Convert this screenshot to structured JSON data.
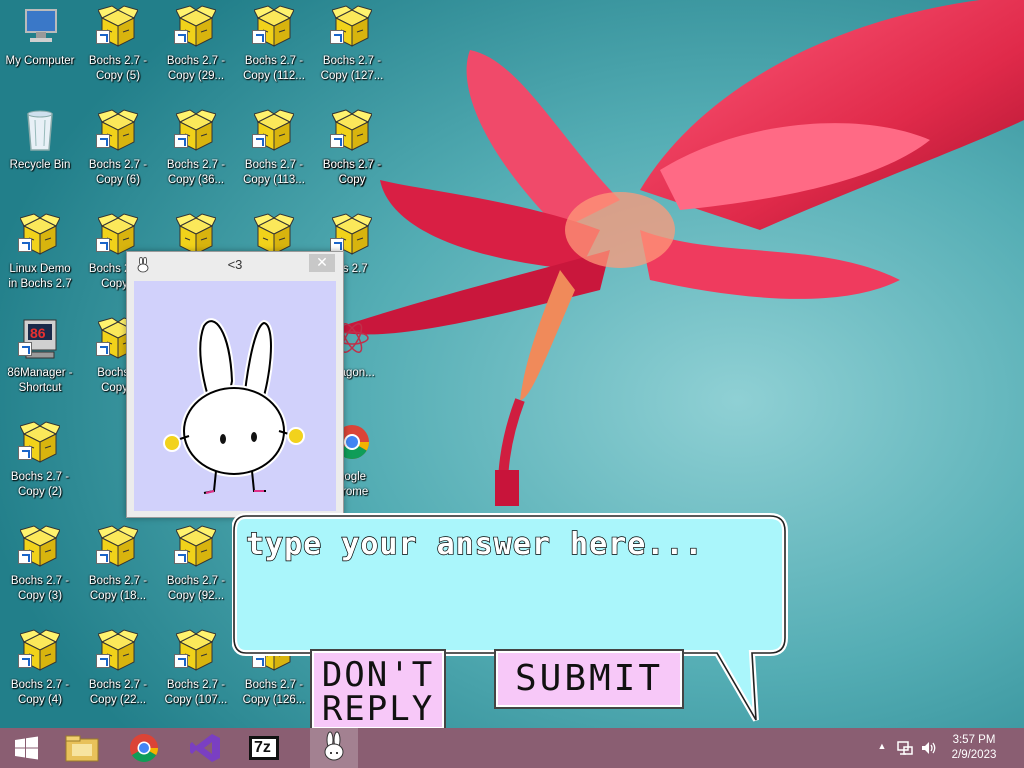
{
  "desktop": {
    "icons": [
      {
        "label": "My Computer",
        "icon": "computer-icon"
      },
      {
        "label": "Recycle Bin",
        "icon": "recycle-bin-icon"
      },
      {
        "label": "Linux Demo\nin Bochs 2.7",
        "icon": "box-icon"
      },
      {
        "label": "86Manager -\nShortcut",
        "icon": "86manager-icon"
      },
      {
        "label": "Bochs 2.7 -\nCopy (2)",
        "icon": "box-icon"
      },
      {
        "label": "Bochs 2.7 -\nCopy (3)",
        "icon": "box-icon"
      },
      {
        "label": "Bochs 2.7 -\nCopy (4)",
        "icon": "box-icon"
      },
      {
        "label": "Bochs 2.7 -\nCopy (5)",
        "icon": "box-icon"
      },
      {
        "label": "Bochs 2.7 -\nCopy (6)",
        "icon": "box-icon"
      },
      {
        "label": "Bochs 2.7 -\nCopy",
        "icon": "box-icon"
      },
      {
        "label": "Bochs 2.7 -\nCopy (",
        "icon": "box-icon"
      },
      {
        "label": "Bochs 2\nCopy (",
        "icon": "box-icon"
      },
      {
        "label": "Bochs 2.7 -\nCopy (18...",
        "icon": "box-icon"
      },
      {
        "label": "Bochs 2.7 -\nCopy (22...",
        "icon": "box-icon"
      },
      {
        "label": "Bochs 2.7 -\nCopy (29...",
        "icon": "box-icon"
      },
      {
        "label": "Bochs 2.7 -\nCopy (36...",
        "icon": "box-icon"
      },
      {
        "label": "Bochs 2.7 -\nCopy (92...",
        "icon": "box-icon"
      },
      {
        "label": "Bochs 2.7 -\nCopy (107...",
        "icon": "box-icon"
      },
      {
        "label": "Bochs 2.7 -\nCopy (112...",
        "icon": "box-icon"
      },
      {
        "label": "Bochs 2.7 -\nCopy (113...",
        "icon": "box-icon"
      },
      {
        "label": "Bochs 2.7 -\nCopy (126...",
        "icon": "box-icon"
      },
      {
        "label": "Bochs 2.7 -\nCopy (127...",
        "icon": "box-icon"
      },
      {
        "label": "Bochs 2.7 -\nCopy",
        "icon": "box-icon"
      },
      {
        "label": "hs 2.7",
        "icon": "box-icon"
      },
      {
        "label": "Wagon...",
        "icon": "atom-icon"
      },
      {
        "label": "oogle\nhrome",
        "icon": "chrome-icon"
      }
    ]
  },
  "popup": {
    "title": "<3",
    "close": "✕"
  },
  "bubble": {
    "answer_placeholder": "type your answer here...",
    "dont_reply": "DON'T\nREPLY",
    "submit": "SUBMIT"
  },
  "taskbar": {
    "items": [
      "start-icon",
      "file-explorer-icon",
      "chrome-icon",
      "visual-studio-icon",
      "7zip-icon",
      "bunny-app-icon"
    ],
    "seven_zip_label": "7z",
    "tray_arrow": "▲",
    "time": "3:57 PM",
    "date": "2/9/2023"
  },
  "colors": {
    "sky": "#2d8e96",
    "flower": "#e0304e",
    "bubble": "#aaf6fb",
    "button": "#f7c8f8",
    "popup_canvas": "#d1d1fb",
    "taskbar": "#8a5e72",
    "box_yellow": "#f4e020"
  }
}
